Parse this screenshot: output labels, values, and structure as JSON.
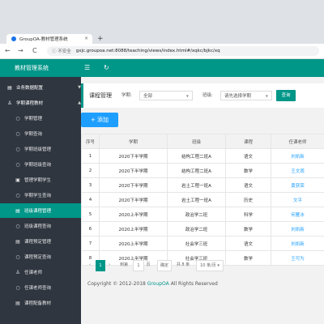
{
  "browser": {
    "tab_title": "GroupOA-教材管理系统",
    "tab_close": "×",
    "new_tab": "+",
    "back": "←",
    "forward": "→",
    "reload": "C",
    "security": "ⓘ 不安全",
    "url": "gxjc.groupoa.net:8088/teaching/views/index.html#/xqkc/bjkc/xq"
  },
  "topbar": {
    "title": "教材管理系统",
    "menu_icon": "☰",
    "refresh_icon": "↻"
  },
  "sidebar": {
    "items": [
      {
        "label": "业务数据配置",
        "icon": "▤",
        "arrow": "▼",
        "top": true
      },
      {
        "label": "学期课程教材",
        "icon": "♙",
        "arrow": "▲",
        "top": true
      },
      {
        "label": "学期管理",
        "icon": "○"
      },
      {
        "label": "学期查询",
        "icon": "○"
      },
      {
        "label": "学期班级管理",
        "icon": "○"
      },
      {
        "label": "学期班级查询",
        "icon": "○"
      },
      {
        "label": "管理学期学生",
        "icon": "▣"
      },
      {
        "label": "学期学生查询",
        "icon": "○"
      },
      {
        "label": "班级课程管理",
        "icon": "▤",
        "active": true
      },
      {
        "label": "班级课程查询",
        "icon": "○"
      },
      {
        "label": "课程预定管理",
        "icon": "▤"
      },
      {
        "label": "课程预定查询",
        "icon": "○"
      },
      {
        "label": "任课老师",
        "icon": "♙"
      },
      {
        "label": "任课老师查询",
        "icon": "○"
      },
      {
        "label": "课程配备教材",
        "icon": "▤"
      }
    ]
  },
  "filter": {
    "title": "课程管理",
    "semester_label": "学期:",
    "semester_value": "全部",
    "class_label": "班级:",
    "class_placeholder": "请先选择学期",
    "query_button": "查询"
  },
  "add_button": "+ 添加",
  "table": {
    "headers": [
      "序号",
      "学期",
      "班级",
      "课程",
      "任课老师"
    ],
    "rows": [
      [
        "1",
        "2020下半学期",
        "结构工程二班A",
        "语文",
        "刘凯新"
      ],
      [
        "2",
        "2020下半学期",
        "结构工程二班A",
        "数学",
        "王文观"
      ],
      [
        "3",
        "2020下半学期",
        "岩土工程一班A",
        "语文",
        "黄获荣"
      ],
      [
        "4",
        "2020下半学期",
        "岩土工程一班A",
        "历史",
        "文平"
      ],
      [
        "5",
        "2020上半学期",
        "政治学二班",
        "科学",
        "何雁冰"
      ],
      [
        "6",
        "2020上半学期",
        "政治学二班",
        "数学",
        "刘凯新"
      ],
      [
        "7",
        "2020上半学期",
        "社会学三班",
        "语文",
        "刘凯新"
      ],
      [
        "8",
        "2020上半学期",
        "社会学三班",
        "数学",
        "王可为"
      ]
    ]
  },
  "pager": {
    "prev": "‹",
    "current": "1",
    "next": "›",
    "goto_label": "到第",
    "goto_value": "1",
    "page_unit": "页",
    "confirm": "确定",
    "total": "共 8 条",
    "page_size": "10 条/页 ▾"
  },
  "footer": {
    "copyright": "Copyright © 2012-2018",
    "brand": "GroupOA",
    "rights": "All Rights Reserved"
  }
}
